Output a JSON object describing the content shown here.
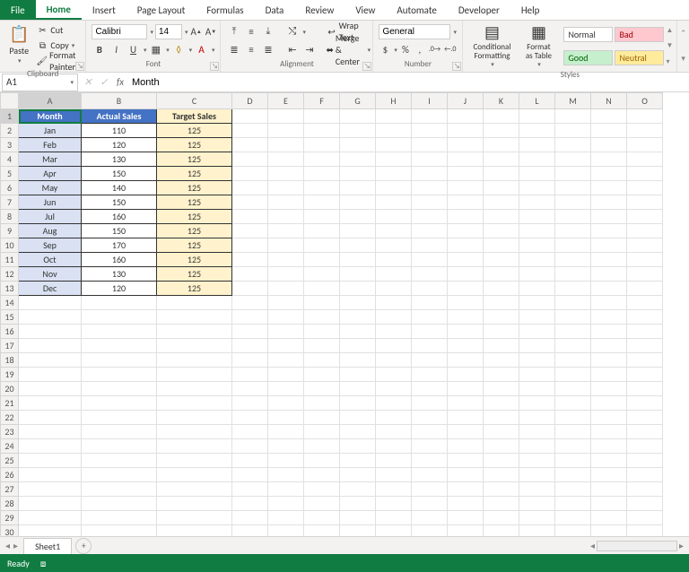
{
  "tabs": {
    "file": "File",
    "items": [
      "Home",
      "Insert",
      "Page Layout",
      "Formulas",
      "Data",
      "Review",
      "View",
      "Automate",
      "Developer",
      "Help"
    ],
    "active": 0
  },
  "ribbon": {
    "clipboard": {
      "paste": "Paste",
      "cut": "Cut",
      "copy": "Copy",
      "format_painter": "Format Painter",
      "label": "Clipboard"
    },
    "font": {
      "name": "Calibri",
      "size": "14",
      "label": "Font"
    },
    "alignment": {
      "wrap": "Wrap Text",
      "merge": "Merge & Center",
      "label": "Alignment"
    },
    "number": {
      "format": "General",
      "label": "Number"
    },
    "styles": {
      "cond": "Conditional Formatting",
      "table": "Format as Table",
      "normal": "Normal",
      "bad": "Bad",
      "good": "Good",
      "neutral": "Neutral",
      "label": "Styles"
    }
  },
  "fbar": {
    "name": "A1",
    "formula": "Month"
  },
  "columns": [
    "A",
    "B",
    "C",
    "D",
    "E",
    "F",
    "G",
    "H",
    "I",
    "J",
    "K",
    "L",
    "M",
    "N",
    "O"
  ],
  "row_count": 30,
  "chart_data": {
    "type": "table",
    "headers": [
      "Month",
      "Actual Sales",
      "Target Sales"
    ],
    "rows": [
      [
        "Jan",
        110,
        125
      ],
      [
        "Feb",
        120,
        125
      ],
      [
        "Mar",
        130,
        125
      ],
      [
        "Apr",
        150,
        125
      ],
      [
        "May",
        140,
        125
      ],
      [
        "Jun",
        150,
        125
      ],
      [
        "Jul",
        160,
        125
      ],
      [
        "Aug",
        150,
        125
      ],
      [
        "Sep",
        170,
        125
      ],
      [
        "Oct",
        160,
        125
      ],
      [
        "Nov",
        130,
        125
      ],
      [
        "Dec",
        120,
        125
      ]
    ]
  },
  "sheet": {
    "name": "Sheet1"
  },
  "status": {
    "text": "Ready"
  }
}
